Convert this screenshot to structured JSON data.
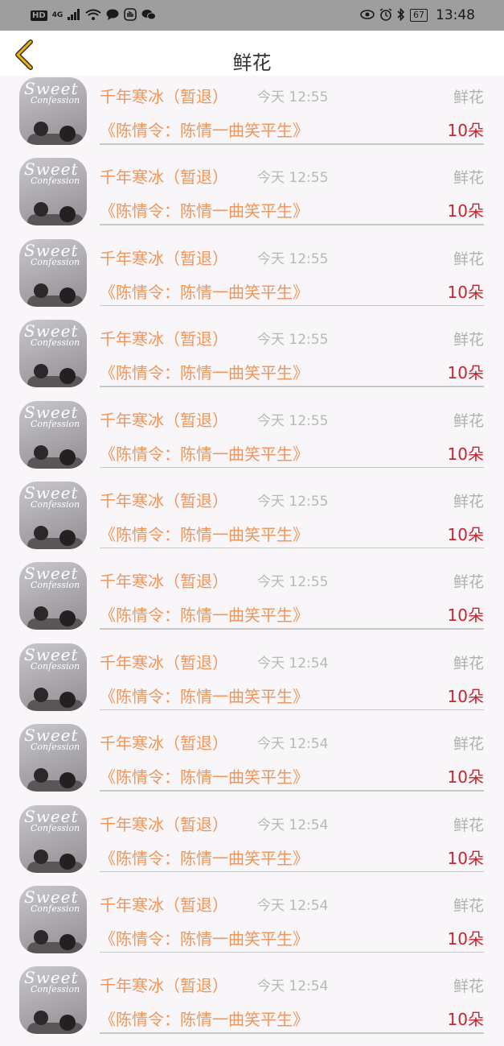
{
  "status_bar": {
    "hd": "HD",
    "network": "4G",
    "time": "13:48",
    "battery": "67"
  },
  "header": {
    "title": "鲜花",
    "back_icon": "chevron-left-icon",
    "back_color": "#f0b400"
  },
  "colors": {
    "accent": "#f0965c",
    "quantity": "#c8242c",
    "muted": "#b8b8b8"
  },
  "records": [
    {
      "name": "千年寒冰（暂退）",
      "time": "今天 12:55",
      "gift": "鲜花",
      "work": "《陈情令：陈情一曲笑平生》",
      "qty": "10朵",
      "avatar": {
        "line1": "Sweet",
        "line2": "Confession"
      }
    },
    {
      "name": "千年寒冰（暂退）",
      "time": "今天 12:55",
      "gift": "鲜花",
      "work": "《陈情令：陈情一曲笑平生》",
      "qty": "10朵",
      "avatar": {
        "line1": "Sweet",
        "line2": "Confession"
      }
    },
    {
      "name": "千年寒冰（暂退）",
      "time": "今天 12:55",
      "gift": "鲜花",
      "work": "《陈情令：陈情一曲笑平生》",
      "qty": "10朵",
      "avatar": {
        "line1": "Sweet",
        "line2": "Confession"
      }
    },
    {
      "name": "千年寒冰（暂退）",
      "time": "今天 12:55",
      "gift": "鲜花",
      "work": "《陈情令：陈情一曲笑平生》",
      "qty": "10朵",
      "avatar": {
        "line1": "Sweet",
        "line2": "Confession"
      }
    },
    {
      "name": "千年寒冰（暂退）",
      "time": "今天 12:55",
      "gift": "鲜花",
      "work": "《陈情令：陈情一曲笑平生》",
      "qty": "10朵",
      "avatar": {
        "line1": "Sweet",
        "line2": "Confession"
      }
    },
    {
      "name": "千年寒冰（暂退）",
      "time": "今天 12:55",
      "gift": "鲜花",
      "work": "《陈情令：陈情一曲笑平生》",
      "qty": "10朵",
      "avatar": {
        "line1": "Sweet",
        "line2": "Confession"
      }
    },
    {
      "name": "千年寒冰（暂退）",
      "time": "今天 12:55",
      "gift": "鲜花",
      "work": "《陈情令：陈情一曲笑平生》",
      "qty": "10朵",
      "avatar": {
        "line1": "Sweet",
        "line2": "Confession"
      }
    },
    {
      "name": "千年寒冰（暂退）",
      "time": "今天 12:54",
      "gift": "鲜花",
      "work": "《陈情令：陈情一曲笑平生》",
      "qty": "10朵",
      "avatar": {
        "line1": "Sweet",
        "line2": "Confession"
      }
    },
    {
      "name": "千年寒冰（暂退）",
      "time": "今天 12:54",
      "gift": "鲜花",
      "work": "《陈情令：陈情一曲笑平生》",
      "qty": "10朵",
      "avatar": {
        "line1": "Sweet",
        "line2": "Confession"
      }
    },
    {
      "name": "千年寒冰（暂退）",
      "time": "今天 12:54",
      "gift": "鲜花",
      "work": "《陈情令：陈情一曲笑平生》",
      "qty": "10朵",
      "avatar": {
        "line1": "Sweet",
        "line2": "Confession"
      }
    },
    {
      "name": "千年寒冰（暂退）",
      "time": "今天 12:54",
      "gift": "鲜花",
      "work": "《陈情令：陈情一曲笑平生》",
      "qty": "10朵",
      "avatar": {
        "line1": "Sweet",
        "line2": "Confession"
      }
    },
    {
      "name": "千年寒冰（暂退）",
      "time": "今天 12:54",
      "gift": "鲜花",
      "work": "《陈情令：陈情一曲笑平生》",
      "qty": "10朵",
      "avatar": {
        "line1": "Sweet",
        "line2": "Confession"
      }
    }
  ]
}
